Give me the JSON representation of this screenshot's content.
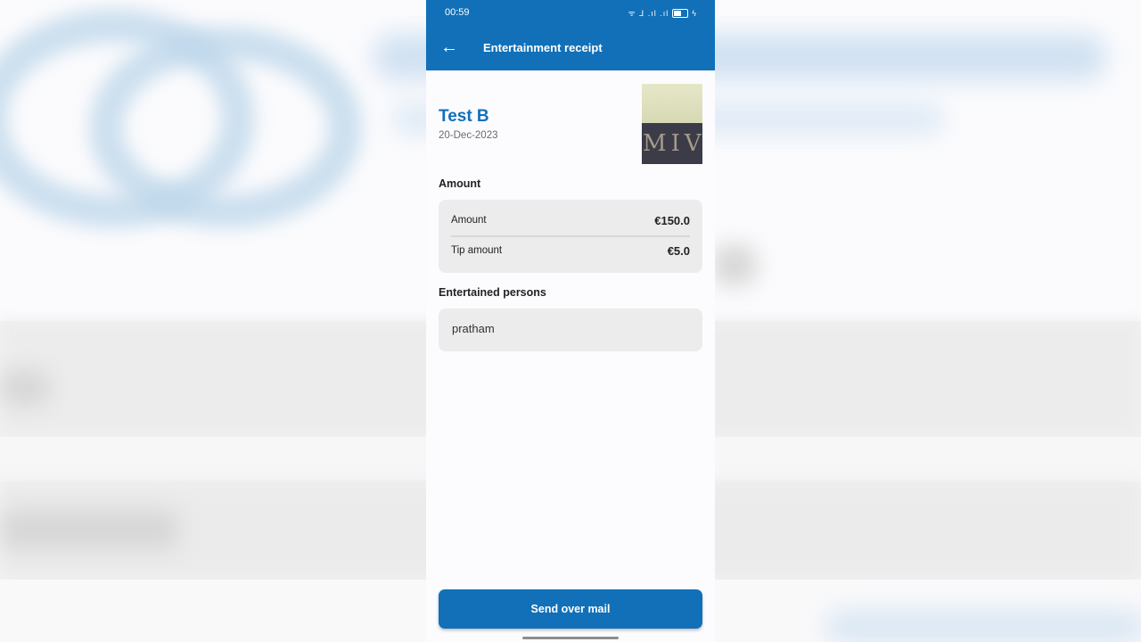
{
  "status_bar": {
    "time": "00:59",
    "signal_text": "ᯤ ⅃ .ıl .ıl",
    "battery_icon": "battery-icon",
    "charging": "ϟ"
  },
  "app_bar": {
    "title": "Entertainment receipt",
    "back_icon": "←"
  },
  "receipt": {
    "name": "Test B",
    "date": "20-Dec-2023",
    "thumbnail_text": "MIV"
  },
  "amount_section": {
    "label": "Amount",
    "rows": [
      {
        "label": "Amount",
        "value": "€150.0"
      },
      {
        "label": "Tip amount",
        "value": "€5.0"
      }
    ]
  },
  "persons_section": {
    "label": "Entertained persons",
    "persons": [
      "pratham"
    ]
  },
  "actions": {
    "send_label": "Send over mail"
  },
  "colors": {
    "primary": "#1170b8",
    "card": "#ececec"
  }
}
